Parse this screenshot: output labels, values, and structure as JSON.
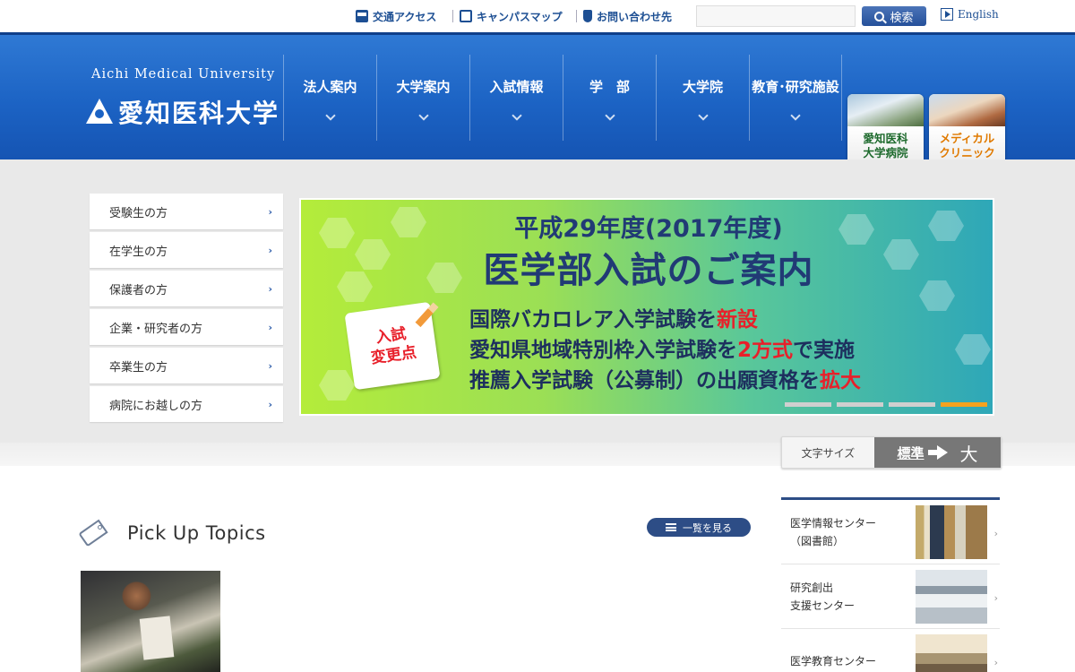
{
  "utility": {
    "access": "交通アクセス",
    "campus_map": "キャンパスマップ",
    "contact": "お問い合わせ先",
    "search_placeholder": "",
    "search_button": "検索",
    "english": "English"
  },
  "logo": {
    "english": "Aichi Medical University",
    "japanese": "愛知医科大学"
  },
  "nav": [
    {
      "label": "法人案内"
    },
    {
      "label": "大学案内"
    },
    {
      "label": "入試情報"
    },
    {
      "label": "学　部"
    },
    {
      "label": "大学院"
    },
    {
      "label": "教育･研究施設"
    }
  ],
  "hospital_links": [
    {
      "line1": "愛知医科",
      "line2": "大学病院"
    },
    {
      "line1": "メディカル",
      "line2": "クリニック"
    }
  ],
  "audience_menu": [
    {
      "label": "受験生の方"
    },
    {
      "label": "在学生の方"
    },
    {
      "label": "保護者の方"
    },
    {
      "label": "企業・研究者の方"
    },
    {
      "label": "卒業生の方"
    },
    {
      "label": "病院にお越しの方"
    }
  ],
  "banner": {
    "title1": "平成29年度(2017年度)",
    "title2": "医学部入試のご案内",
    "badge_line1": "入試",
    "badge_line2": "変更点",
    "line1_pre": "国際バカロレア入学試験を",
    "line1_red": "新設",
    "line2_pre": "愛知県地域特別枠入学試験を",
    "line2_red": "2方式",
    "line2_post": "で実施",
    "line3_pre": "推薦入学試験（公募制）の出願資格を",
    "line3_red": "拡大",
    "slide_count": 4,
    "active_slide": 4
  },
  "font_size": {
    "label": "文字サイズ",
    "standard": "標準",
    "large": "大"
  },
  "pickup": {
    "title": "Pick Up Topics",
    "list_button": "一覧を見る"
  },
  "facility_links": [
    {
      "line1": "医学情報センター",
      "line2": "（図書館）"
    },
    {
      "line1": "研究創出",
      "line2": "支援センター"
    },
    {
      "line1": "医学教育センター",
      "line2": ""
    }
  ],
  "colors": {
    "header_blue": "#1c63c4",
    "navy": "#2d4d86",
    "accent_red": "#e8202a",
    "slide_active": "#f4a21e"
  }
}
